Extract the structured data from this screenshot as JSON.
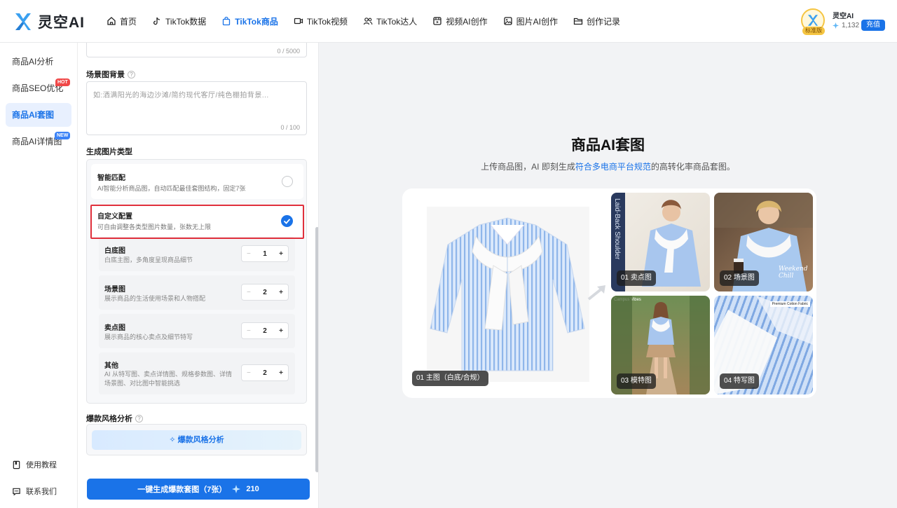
{
  "brand": {
    "name": "灵空AI"
  },
  "nav": [
    {
      "label": "首页",
      "icon": "home-icon"
    },
    {
      "label": "TikTok数据",
      "icon": "tiktok-icon"
    },
    {
      "label": "TikTok商品",
      "icon": "shopping-bag-icon",
      "active": true
    },
    {
      "label": "TikTok视频",
      "icon": "video-icon"
    },
    {
      "label": "TikTok达人",
      "icon": "users-icon"
    },
    {
      "label": "视频AI创作",
      "icon": "film-icon"
    },
    {
      "label": "图片AI创作",
      "icon": "image-icon"
    },
    {
      "label": "创作记录",
      "icon": "folder-icon"
    }
  ],
  "user": {
    "name": "灵空AI",
    "tier": "标准版",
    "credits": "1,132",
    "recharge": "充值"
  },
  "sidebar": {
    "items": [
      {
        "label": "商品AI分析"
      },
      {
        "label": "商品SEO优化",
        "tag": "HOT"
      },
      {
        "label": "商品AI套图",
        "active": true
      },
      {
        "label": "商品AI详情图",
        "tag": "NEW"
      }
    ],
    "bottom": [
      {
        "label": "使用教程"
      },
      {
        "label": "联系我们"
      }
    ]
  },
  "form": {
    "top_counter": "0 / 5000",
    "scene_label": "场景图背景",
    "scene_placeholder": "如:洒满阳光的海边沙滩/简约现代客厅/纯色棚拍背景...",
    "scene_counter": "0 / 100",
    "type_label": "生成图片类型",
    "options": [
      {
        "title": "智能匹配",
        "desc": "AI智能分析商品图，自动匹配最佳套图结构，固定7张"
      },
      {
        "title": "自定义配置",
        "desc": "可自由调整各类型图片数量，张数无上限"
      }
    ],
    "rows": [
      {
        "title": "白底图",
        "desc": "白底主图，多角度呈现商品细节",
        "value": "1"
      },
      {
        "title": "场景图",
        "desc": "展示商品的生活使用场景和人物搭配",
        "value": "2"
      },
      {
        "title": "卖点图",
        "desc": "展示商品的核心卖点及细节特写",
        "value": "2"
      },
      {
        "title": "其他",
        "desc1": "AI 从特写图、卖点详情图、规格参数图、详情",
        "desc2": "场景图、对比图中智能挑选",
        "value": "2"
      }
    ],
    "style_label": "爆款风格分析",
    "style_button": "爆款风格分析",
    "generate_button": "一键生成爆款套图（7张）",
    "generate_cost": "210"
  },
  "main": {
    "title": "商品AI套图",
    "sub_before": "上传商品图，AI 即刻生成",
    "sub_link": "符合多电商平台规范",
    "sub_after": "的高转化率商品套图。",
    "captions": [
      "01 主图（白底/合规）",
      "01 卖点图",
      "02 场景图",
      "03 模特图",
      "04 特写图"
    ],
    "photo_text": {
      "sell": "Laid-Back Shoulder",
      "scene": "Weekend Chill",
      "model": "Campus Vibes",
      "detail": "Premium Cotton Fabric"
    }
  },
  "colors": {
    "accent": "#1a73e8",
    "hot": "#f04848",
    "highlight": "#e0303c"
  }
}
